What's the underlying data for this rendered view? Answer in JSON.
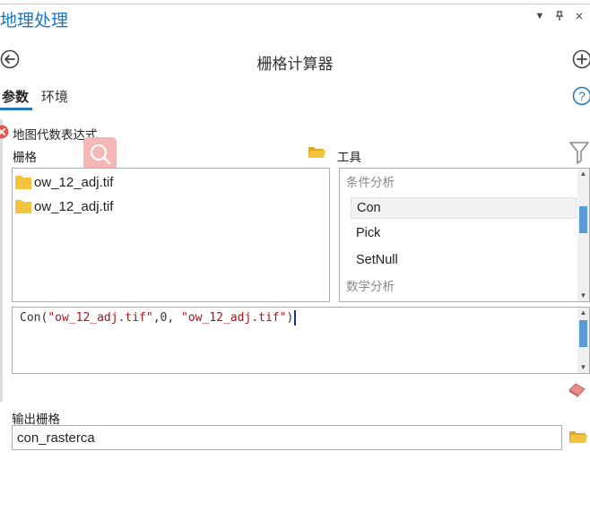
{
  "pane": {
    "title": "地理处理"
  },
  "tool": {
    "title": "栅格计算器"
  },
  "tabs": [
    {
      "label": "参数",
      "active": true
    },
    {
      "label": "环境",
      "active": false
    }
  ],
  "expression_section": {
    "label": "地图代数表达式",
    "rasters_label": "栅格",
    "tools_label": "工具",
    "rasters": [
      {
        "name": "ow_12_adj.tif",
        "icon": "raster-file-icon"
      },
      {
        "name": "ow_12_adj.tif",
        "icon": "raster-file-icon"
      }
    ],
    "tool_list": [
      {
        "label": "条件分析",
        "kind": "category"
      },
      {
        "label": "Con",
        "kind": "function",
        "selected": true
      },
      {
        "label": "Pick",
        "kind": "function"
      },
      {
        "label": "SetNull",
        "kind": "function"
      },
      {
        "label": "数学分析",
        "kind": "category"
      }
    ],
    "expression": {
      "fn": "Con(",
      "arg1": "\"ow_12_adj.tif\"",
      "mid": ",0, ",
      "arg3": "\"ow_12_adj.tif\"",
      "close": ")"
    }
  },
  "output": {
    "label": "输出栅格",
    "value": "con_rasterca"
  },
  "colors": {
    "accent": "#1f76c2",
    "error": "#e05b4b",
    "folder": "#f2c53d",
    "search_highlight": "#f6b6b6",
    "scroll_thumb": "#5b9bd5"
  },
  "icons": [
    "back-icon",
    "add-icon",
    "help-icon",
    "error-icon",
    "search-icon",
    "folder-icon",
    "filter-icon",
    "eraser-icon"
  ]
}
